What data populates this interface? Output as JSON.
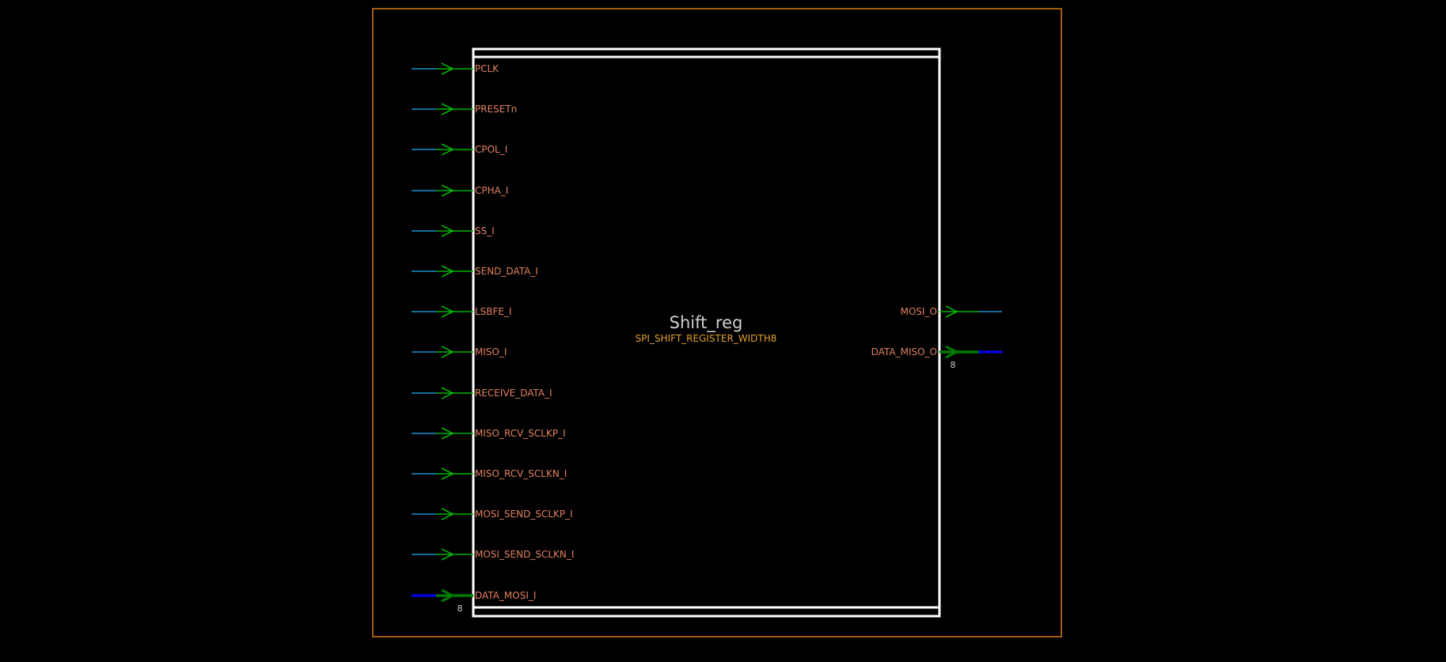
{
  "block": {
    "instance_name": "Shift_reg",
    "cell_name": "SPI_SHIFT_REGISTER_WIDTH8"
  },
  "colors": {
    "background": "#000000",
    "boundary": "#d97a1a",
    "block_outline": "#ffffff",
    "wire": "#1a8fd0",
    "bus_wire": "#0000e0",
    "pin_stub": "#00b000",
    "bus_stub": "#007a00",
    "arrow": "#00cc00",
    "pin_label": "#e08060",
    "instance_label": "#d0d0d0",
    "cell_label": "#e0a030"
  },
  "input_pins": [
    {
      "name": "PCLK",
      "bus": false
    },
    {
      "name": "PRESETn",
      "bus": false
    },
    {
      "name": "CPOL_I",
      "bus": false
    },
    {
      "name": "CPHA_I",
      "bus": false
    },
    {
      "name": "SS_I",
      "bus": false
    },
    {
      "name": "SEND_DATA_I",
      "bus": false
    },
    {
      "name": "LSBFE_I",
      "bus": false
    },
    {
      "name": "MISO_I",
      "bus": false
    },
    {
      "name": "RECEIVE_DATA_I",
      "bus": false
    },
    {
      "name": "MISO_RCV_SCLKP_I",
      "bus": false
    },
    {
      "name": "MISO_RCV_SCLKN_I",
      "bus": false
    },
    {
      "name": "MOSI_SEND_SCLKP_I",
      "bus": false
    },
    {
      "name": "MOSI_SEND_SCLKN_I",
      "bus": false
    },
    {
      "name": "DATA_MOSI_I",
      "bus": true,
      "width": "8"
    }
  ],
  "output_pins": [
    {
      "name": "MOSI_O",
      "bus": false,
      "row": 6
    },
    {
      "name": "DATA_MISO_O",
      "bus": true,
      "width": "8",
      "row": 7
    }
  ]
}
